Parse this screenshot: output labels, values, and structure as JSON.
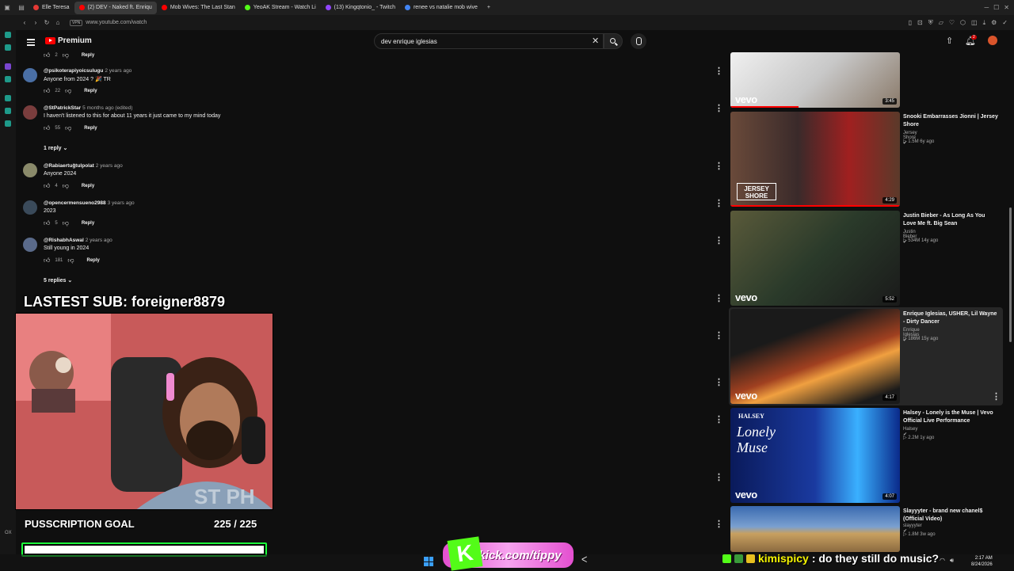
{
  "browser": {
    "tabs": [
      {
        "label": "Elle Teresa",
        "color": "#e53935"
      },
      {
        "label": "(2) DEV - Naked ft. Enriqu",
        "color": "#ff0000",
        "active": true
      },
      {
        "label": "Mob Wives: The Last Stan",
        "color": "#ff0000"
      },
      {
        "label": "YeoAK Stream - Watch Li",
        "color": "#53fc18"
      },
      {
        "label": "(13) Kingqtonio_ - Twitch",
        "color": "#9146ff"
      },
      {
        "label": "renee vs natalie mob wive",
        "color": "#4285f4"
      }
    ],
    "new_tab": "+",
    "vpn": "VPN",
    "url": "www.youtube.com/watch"
  },
  "youtube": {
    "logo_text": "Premium",
    "search_value": "dev enrique iglesias",
    "notification_count": "2"
  },
  "comments": [
    {
      "likes": "2",
      "reply": "Reply"
    },
    {
      "user": "@psikoterapiyoicsulugu",
      "time": "2 years ago",
      "text": "Anyone from 2024 ? 🎉 TR",
      "likes": "22",
      "reply": "Reply",
      "color": "#4a6fa5"
    },
    {
      "user": "@StPatrickStar",
      "time": "5 months ago (edited)",
      "text": "I haven't listened to this for about 11 years it just came to my mind today",
      "likes": "55",
      "reply": "Reply",
      "color": "#7a3d3d"
    },
    {
      "user": "@Rabiaertuğtulpolat",
      "time": "2 years ago",
      "text": "Anyone 2024",
      "likes": "4",
      "reply": "Reply",
      "color": "#8a8a6a"
    },
    {
      "user": "@opencermensueno2988",
      "time": "3 years ago",
      "text": "2023",
      "likes": "5",
      "reply": "Reply",
      "color": "#3a4a5a"
    },
    {
      "user": "@RishabhAswal",
      "time": "2 years ago",
      "text": "Still young in 2024",
      "likes": "181",
      "reply": "Reply",
      "color": "#5a6a8a"
    }
  ],
  "replies_toggles": [
    "1 reply",
    "5 replies"
  ],
  "overlay": {
    "latest_sub": "LASTEST SUB: foreigner8879",
    "goal_label": "PUSSCRIPTION GOAL",
    "goal_count": "225 / 225",
    "goal_progress": 1.0,
    "kick_url": "kick.com/tippy",
    "kick_logo": "K",
    "chat_user": "kimispicy",
    "chat_message": ": do they still do music?"
  },
  "recommendations": [
    {
      "title": "",
      "channel": "",
      "meta": "",
      "duration": "3:45",
      "vevo": "vevo",
      "colors": [
        "#e8e8e8",
        "#8a7a6a"
      ]
    },
    {
      "title": "Snooki Embarrasses Jionni | Jersey Shore",
      "channel": "Jersey Shore",
      "meta": "1.5M  6y ago",
      "duration": "4:29",
      "vevo": "",
      "colors": [
        "#5a3a2a",
        "#a02020"
      ]
    },
    {
      "title": "Justin Bieber - As Long As You Love Me ft. Big Sean",
      "channel": "Justin Bieber",
      "meta": "534M  14y ago",
      "duration": "5:52",
      "vevo": "vevo",
      "colors": [
        "#2a3a2a",
        "#6a6a4a"
      ]
    },
    {
      "title": "Enrique Iglesias, USHER, Lil Wayne - Dirty Dancer",
      "channel": "Enrique Iglesias",
      "meta": "186M  15y ago",
      "duration": "4:17",
      "vevo": "vevo",
      "colors": [
        "#1a1a1a",
        "#e86a2a"
      ]
    },
    {
      "title": "Halsey - Lonely is the Muse | Vevo Official Live Performance",
      "channel": "Halsey",
      "meta": "2.2M  1y ago",
      "duration": "4:07",
      "vevo": "vevo",
      "colors": [
        "#0a2a8a",
        "#3ab0ff"
      ],
      "thumb_text": "Lonely Muse",
      "thumb_small": "HALSEY"
    },
    {
      "title": "Slayyyter - brand new chanel$ (Official Video)",
      "channel": "slayyyter",
      "meta": "1.8M  3w ago",
      "duration": "",
      "vevo": "",
      "colors": [
        "#3a6ab0",
        "#c8a060"
      ]
    }
  ],
  "clock": {
    "time": "2:17 AM",
    "date": "8/24/2026"
  },
  "side_label": "OX"
}
